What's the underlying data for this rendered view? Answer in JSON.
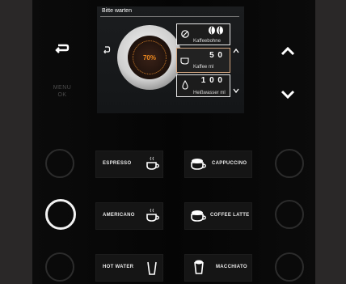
{
  "screen": {
    "title": "Bitte warten",
    "progress_text": "70%",
    "progress": 0.7,
    "params": [
      {
        "value": "",
        "label": "Kaffeebohne",
        "icon": "bean-icon"
      },
      {
        "value": "5 0",
        "label": "Kaffee ml",
        "icon": "cup-icon"
      },
      {
        "value": "1 0 0",
        "label": "Heißwasser ml",
        "icon": "drop-icon"
      }
    ]
  },
  "hardware": {
    "menu_label": "MENU",
    "ok_label": "OK"
  },
  "drinks": {
    "espresso": "ESPRESSO",
    "cappuccino": "CAPPUCCINO",
    "americano": "AMERICANO",
    "coffee_latte": "COFFEE LATTE",
    "hot_water": "HOT WATER",
    "macchiato": "MACCHIATO"
  },
  "colors": {
    "accent": "#f08a1e",
    "selected_ring": "#f2f2f2"
  }
}
